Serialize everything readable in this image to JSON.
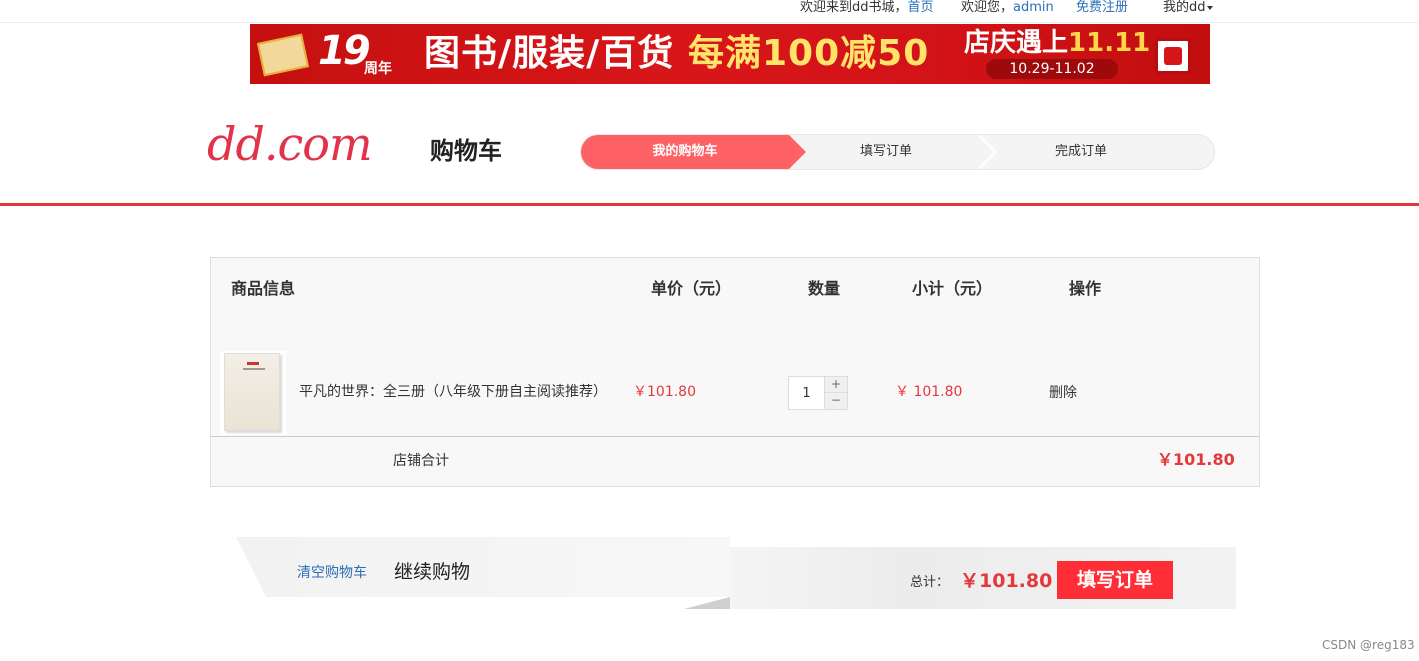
{
  "topbar": {
    "welcome": "欢迎来到dd书城，",
    "home_link": "首页",
    "greeting": "欢迎您，",
    "username": "admin",
    "register_link": "免费注册",
    "my_dd": "我的dd"
  },
  "banner": {
    "anniversary_number": "19",
    "anniversary_word": "周年",
    "categories": "图书/服装/百货",
    "promo": "每满100减50",
    "event_prefix": "店庆遇上",
    "event_suffix": "11.11",
    "dates": "10.29-11.02"
  },
  "header": {
    "logo": "dd.com",
    "title": "购物车"
  },
  "steps": [
    {
      "label": "我的购物车",
      "active": true
    },
    {
      "label": "填写订单",
      "active": false
    },
    {
      "label": "完成订单",
      "active": false
    }
  ],
  "cart": {
    "columns": [
      "商品信息",
      "单价（元）",
      "数量",
      "小计（元）",
      "操作"
    ],
    "items": [
      {
        "name": "平凡的世界：全三册（八年级下册自主阅读推荐）",
        "unit_price": "￥101.80",
        "quantity": "1",
        "subtotal": "￥ 101.80",
        "action": "删除"
      }
    ],
    "qty_plus": "+",
    "qty_minus": "−",
    "store_total_label": "店铺合计",
    "store_total": "￥101.80"
  },
  "footer_bar": {
    "clear_cart": "清空购物车",
    "continue_shopping": "继续购物",
    "total_label": "总计：",
    "total_value": "￥101.80",
    "submit_label": "填写订单"
  },
  "watermark": "CSDN @reg183",
  "colors": {
    "accent": "#e4393c",
    "step_active": "#ff6265",
    "link": "#2a6fb8",
    "submit": "#ff2d36"
  }
}
